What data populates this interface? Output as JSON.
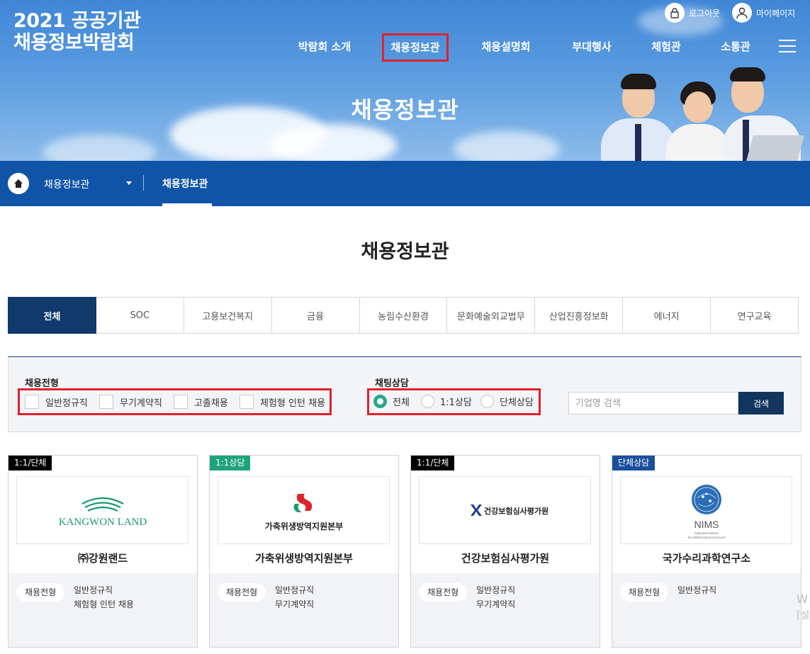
{
  "header": {
    "logo_line1": "2021 공공기관",
    "logo_line2": "채용정보박람회",
    "logout_label": "로그아웃",
    "mypage_label": "마이페이지",
    "nav": [
      {
        "label": "박람회 소개",
        "active": false
      },
      {
        "label": "채용정보관",
        "active": true
      },
      {
        "label": "채용설명회",
        "active": false
      },
      {
        "label": "부대행사",
        "active": false
      },
      {
        "label": "체험관",
        "active": false
      },
      {
        "label": "소통관",
        "active": false
      }
    ],
    "hero_title": "채용정보관"
  },
  "breadcrumb": {
    "level1": "채용정보관",
    "level2": "채용정보관"
  },
  "main": {
    "page_title": "채용정보관",
    "tabs": [
      {
        "label": "전체",
        "active": true
      },
      {
        "label": "SOC",
        "active": false
      },
      {
        "label": "고용보건복지",
        "active": false
      },
      {
        "label": "금융",
        "active": false
      },
      {
        "label": "농림수산환경",
        "active": false
      },
      {
        "label": "문화예술외교법무",
        "active": false
      },
      {
        "label": "산업진흥정보화",
        "active": false
      },
      {
        "label": "에너지",
        "active": false
      },
      {
        "label": "연구교육",
        "active": false
      }
    ]
  },
  "filter": {
    "employment_label": "채용전형",
    "employment_options": [
      "일반정규직",
      "무기계약직",
      "고졸채용",
      "체험형 인턴 채용"
    ],
    "chat_label": "채팅상담",
    "chat_options": [
      "전체",
      "1:1상담",
      "단체상담"
    ],
    "chat_selected": "전체",
    "search_placeholder": "기업명 검색",
    "search_button": "검색"
  },
  "cards": [
    {
      "badge": "1:1/단체",
      "badge_color": "#000000",
      "logo_text": "KANGWON LAND",
      "name": "㈜강원랜드",
      "pill": "채용전형",
      "types": [
        "일반정규직",
        "체험형 인턴 채용"
      ]
    },
    {
      "badge": "1:1상담",
      "badge_color": "#1fa37c",
      "logo_text": "가축위생방역지원본부",
      "name": "가축위생방역지원본부",
      "pill": "채용전형",
      "types": [
        "일반정규직",
        "무기계약직"
      ]
    },
    {
      "badge": "1:1/단체",
      "badge_color": "#000000",
      "logo_text": "건강보험심사평가원",
      "name": "건강보험심사평가원",
      "pill": "채용전형",
      "types": [
        "일반정규직",
        "무기계약직"
      ]
    },
    {
      "badge": "단체상담",
      "badge_color": "#1a4f9c",
      "logo_text": "NIMS",
      "logo_subtext": "National Institute for Mathematical Sciences",
      "name": "국가수리과학연구소",
      "pill": "채용전형",
      "types": [
        "일반정규직"
      ]
    }
  ],
  "watermark": {
    "line1": "W",
    "line2": "[설"
  }
}
